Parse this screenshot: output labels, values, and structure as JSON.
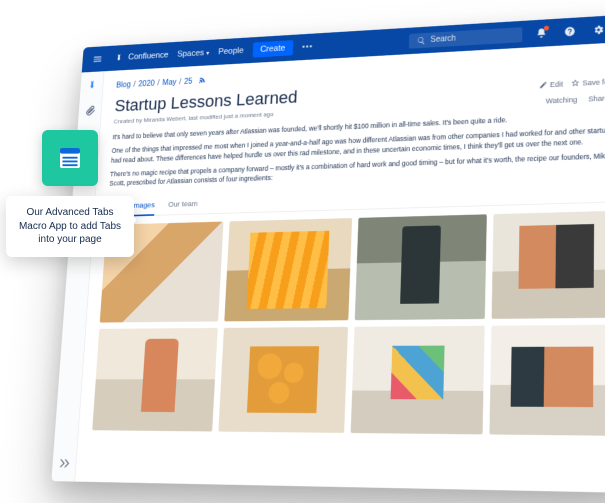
{
  "topbar": {
    "brand": "Confluence",
    "nav": {
      "spaces": "Spaces",
      "people": "People"
    },
    "create": "Create",
    "search_placeholder": "Search"
  },
  "breadcrumb": {
    "a": "Blog",
    "b": "2020",
    "c": "May",
    "d": "25"
  },
  "page": {
    "title": "Startup Lessons Learned",
    "created_by": "Created by Miranda Webert, last modified just a moment ago"
  },
  "actions": {
    "edit": "Edit",
    "save_for_later": "Save for later",
    "watching": "Watching",
    "share": "Share"
  },
  "body": {
    "p1": "It's hard to believe that only seven years after Atlassian was founded, we'll shortly hit $100 million in all-time sales. It's been quite a ride.",
    "p2": "One of the things that impressed me most when I joined a year-and-a-half ago was how different Atlassian was from other companies I had worked for and other startups I had read about. These differences have helped hurdle us over this rad milestone, and in these uncertain economic times, I think they'll get us over the next one.",
    "p3": "There's no magic recipe that propels a company forward – mostly it's a combination of hard work and good timing – but for what it's worth, the recipe our founders, Mike and Scott, prescribed for Atlassian consists of four ingredients:"
  },
  "tabs": {
    "t1": "Startup images",
    "t2": "Our team"
  },
  "callout": {
    "text": "Our Advanced Tabs Macro App to add Tabs into your page"
  }
}
